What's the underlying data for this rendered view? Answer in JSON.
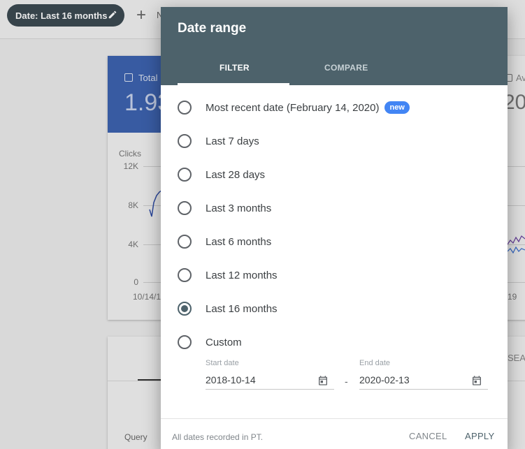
{
  "background": {
    "date_chip_label": "Date: Last 16 months",
    "add_filter_label": "N",
    "metric_left": {
      "label": "Total",
      "value": "1.93"
    },
    "metric_right": {
      "label": "Av",
      "value": "20"
    },
    "chart": {
      "axis_title": "Clicks",
      "y_ticks": [
        "12K",
        "8K",
        "4K",
        "0"
      ],
      "x_left": "10/14/1",
      "x_right": "19"
    },
    "table": {
      "right_tab": "SEA",
      "query_header": "Query"
    }
  },
  "dialog": {
    "title": "Date range",
    "tabs": [
      {
        "label": "FILTER",
        "active": true
      },
      {
        "label": "COMPARE",
        "active": false
      }
    ],
    "options": [
      {
        "label": "Most recent date (February 14, 2020)",
        "badge": "new",
        "selected": false
      },
      {
        "label": "Last 7 days",
        "selected": false
      },
      {
        "label": "Last 28 days",
        "selected": false
      },
      {
        "label": "Last 3 months",
        "selected": false
      },
      {
        "label": "Last 6 months",
        "selected": false
      },
      {
        "label": "Last 12 months",
        "selected": false
      },
      {
        "label": "Last 16 months",
        "selected": true
      },
      {
        "label": "Custom",
        "selected": false
      }
    ],
    "custom": {
      "start_label": "Start date",
      "start_value": "2018-10-14",
      "separator": "-",
      "end_label": "End date",
      "end_value": "2020-02-13"
    },
    "footer_note": "All dates recorded in PT.",
    "cancel_label": "CANCEL",
    "apply_label": "APPLY"
  },
  "colors": {
    "header": "#4d626b",
    "badge": "#4285f4",
    "metric_blue": "#3d63b0"
  },
  "icons": [
    "pencil-icon",
    "add-icon",
    "calendar-icon",
    "checkbox-icon"
  ]
}
